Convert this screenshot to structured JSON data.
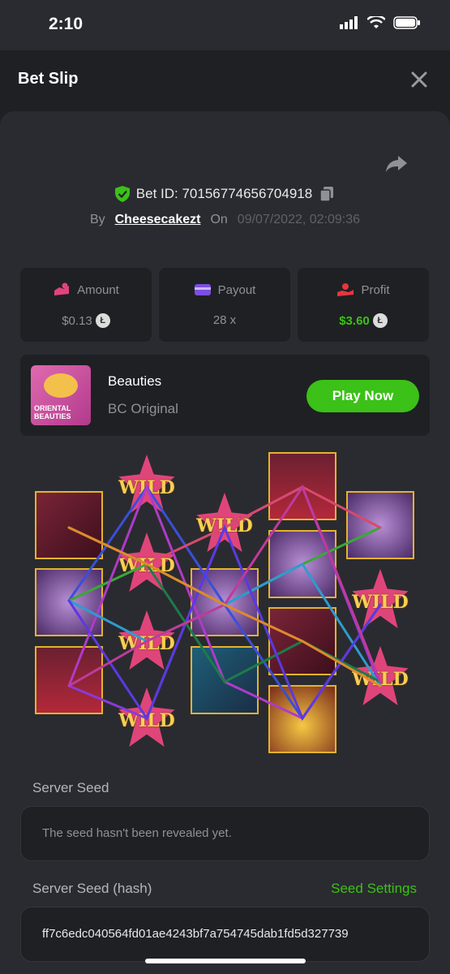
{
  "status": {
    "time": "2:10"
  },
  "header": {
    "title": "Bet Slip"
  },
  "bet": {
    "id_label": "Bet ID: 70156774656704918",
    "by_label": "By",
    "user": "Cheesecakezt",
    "on_label": "On",
    "datetime": "09/07/2022, 02:09:36"
  },
  "stats": {
    "amount": {
      "label": "Amount",
      "value": "$0.13"
    },
    "payout": {
      "label": "Payout",
      "value": "28 x"
    },
    "profit": {
      "label": "Profit",
      "value": "$3.60"
    }
  },
  "game": {
    "name": "Beauties",
    "provider": "BC Original",
    "play_label": "Play Now",
    "thumb_text_1": "ORIENTAL",
    "thumb_text_2": "BEAUTIES"
  },
  "reels": {
    "wild_label": "WILD"
  },
  "server_seed": {
    "label": "Server Seed",
    "value": "The seed hasn't been revealed yet."
  },
  "server_seed_hash": {
    "label": "Server Seed (hash)",
    "settings_label": "Seed Settings",
    "value": "ff7c6edc040564fd01ae4243bf7a754745dab1fd5d327739"
  },
  "colors": {
    "accent_green": "#3bc117",
    "background": "#1f2024",
    "card": "#2a2b30"
  }
}
